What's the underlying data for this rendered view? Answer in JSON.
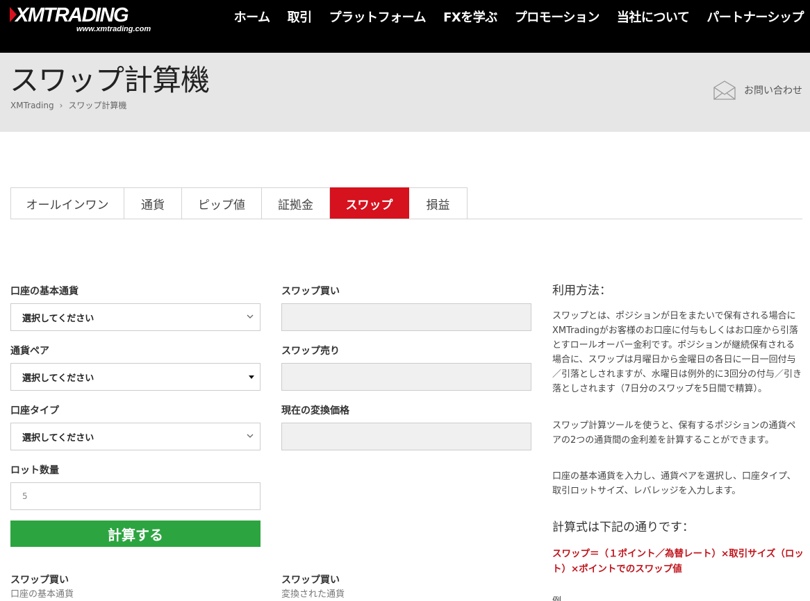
{
  "logo": {
    "text": "XMTRADING",
    "url": "www.xmtrading.com"
  },
  "nav": {
    "items": [
      "ホーム",
      "取引",
      "プラットフォーム",
      "FXを学ぶ",
      "プロモーション",
      "当社について",
      "パートナーシップ"
    ]
  },
  "header": {
    "title": "スワップ計算機",
    "breadcrumb": [
      "XMTrading",
      "スワップ計算機"
    ],
    "breadcrumb_sep": "›",
    "contact_label": "お問い合わせ"
  },
  "tabs": [
    {
      "label": "オールインワン",
      "active": false
    },
    {
      "label": "通貨",
      "active": false
    },
    {
      "label": "ピップ値",
      "active": false
    },
    {
      "label": "証拠金",
      "active": false
    },
    {
      "label": "スワップ",
      "active": true
    },
    {
      "label": "損益",
      "active": false
    }
  ],
  "form": {
    "base_currency": {
      "label": "口座の基本通貨",
      "value": "選択してください"
    },
    "currency_pair": {
      "label": "通貨ペア",
      "value": "選択してください"
    },
    "account_type": {
      "label": "口座タイプ",
      "value": "選択してください"
    },
    "lot": {
      "label": "ロット数量",
      "placeholder": "5"
    },
    "swap_buy": {
      "label": "スワップ買い",
      "value": ""
    },
    "swap_sell": {
      "label": "スワップ売り",
      "value": ""
    },
    "conversion_price": {
      "label": "現在の変換価格",
      "value": ""
    },
    "calculate_label": "計算する"
  },
  "results": {
    "left": {
      "label": "スワップ買い",
      "sub": "口座の基本通貨"
    },
    "right": {
      "label": "スワップ買い",
      "sub": "変換された通貨"
    }
  },
  "howto": {
    "title": "利用方法：",
    "paragraphs": [
      "スワップとは、ポジションが日をまたいで保有される場合にXMTradingがお客様のお口座に付与もしくはお口座から引落とすロールオーバー金利です。ポジションが継続保有される場合に、スワップは月曜日から金曜日の各日に一日一回付与／引落としされますが、水曜日は例外的に3回分の付与／引き落としされます（7日分のスワップを5日間で精算）。",
      "スワップ計算ツールを使うと、保有するポジションの通貨ペアの2つの通貨間の金利差を計算することができます。",
      "口座の基本通貨を入力し、通貨ペアを選択し、口座タイプ、取引ロットサイズ、レバレッジを入力します。"
    ],
    "formula_title": "計算式は下記の通りです：",
    "formula": "スワップ＝（１ポイント／為替レート）×取引サイズ（ロット）×ポイントでのスワップ値",
    "cut_text": "例"
  },
  "colors": {
    "accent_red": "#d5121e",
    "button_green": "#2ca540",
    "formula_red": "#c0141c"
  }
}
